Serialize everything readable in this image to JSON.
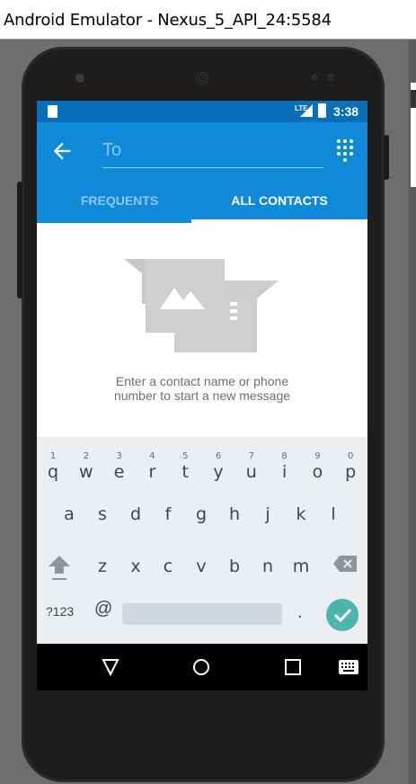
{
  "window": {
    "title": "Android Emulator - Nexus_5_API_24:5584"
  },
  "statusbar": {
    "network": "LTE",
    "time": "3:38"
  },
  "toolbar": {
    "to_placeholder": "To",
    "tabs": [
      {
        "label": "FREQUENTS",
        "selected": false
      },
      {
        "label": "ALL CONTACTS",
        "selected": true
      }
    ]
  },
  "empty_state": {
    "line1": "Enter a contact name or phone",
    "line2": "number to start a new message"
  },
  "keyboard": {
    "row1": [
      {
        "ch": "q",
        "hint": "1"
      },
      {
        "ch": "w",
        "hint": "2"
      },
      {
        "ch": "e",
        "hint": "3"
      },
      {
        "ch": "r",
        "hint": "4"
      },
      {
        "ch": "t",
        "hint": "5"
      },
      {
        "ch": "y",
        "hint": "6"
      },
      {
        "ch": "u",
        "hint": "7"
      },
      {
        "ch": "i",
        "hint": "8"
      },
      {
        "ch": "o",
        "hint": "9"
      },
      {
        "ch": "p",
        "hint": "0"
      }
    ],
    "row2": [
      "a",
      "s",
      "d",
      "f",
      "g",
      "h",
      "j",
      "k",
      "l"
    ],
    "row3": [
      "z",
      "x",
      "c",
      "v",
      "b",
      "n",
      "m"
    ],
    "symbols_label": "?123",
    "at_label": "@",
    "period_label": "."
  },
  "colors": {
    "statusbar": "#0a6fb9",
    "toolbar": "#1089d8",
    "keyboard_bg": "#eceff1",
    "enter_key": "#4db6ac"
  },
  "icons": [
    "back-arrow-icon",
    "dialpad-icon",
    "shift-icon",
    "backspace-icon",
    "check-icon",
    "nav-back-icon",
    "nav-home-icon",
    "nav-recents-icon",
    "keyboard-icon"
  ]
}
